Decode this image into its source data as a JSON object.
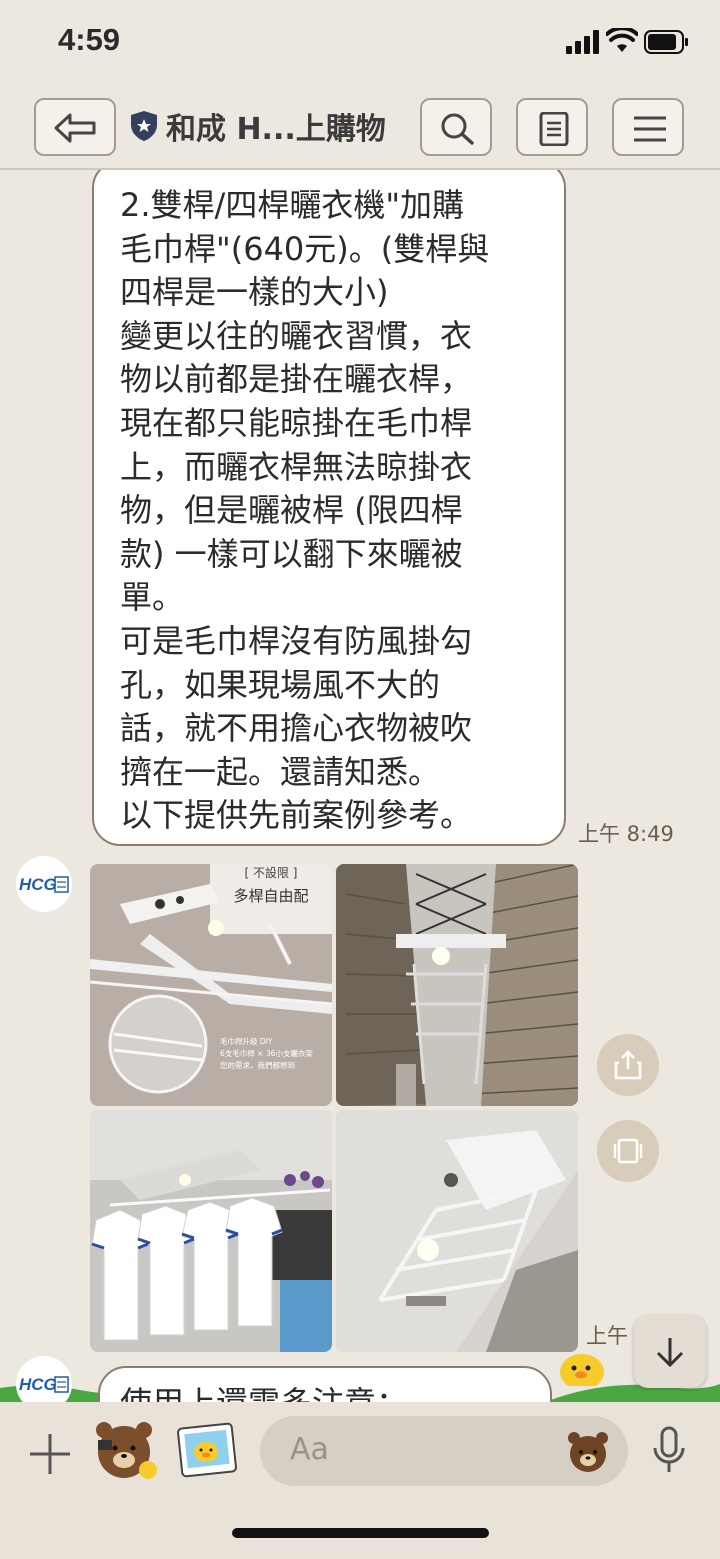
{
  "status_bar": {
    "time": "4:59"
  },
  "header": {
    "title": "和成 H...上購物"
  },
  "messages": [
    {
      "type": "text",
      "lines": [
        "2.雙桿/四桿曬衣機\"加購",
        "毛巾桿\"(640元)。(雙桿與",
        "四桿是一樣的大小)",
        "變更以往的曬衣習慣，衣",
        "物以前都是掛在曬衣桿，",
        "現在都只能晾掛在毛巾桿",
        "上，而曬衣桿無法晾掛衣",
        "物，但是曬被桿 (限四桿",
        "款) 一樣可以翻下來曬被",
        "單。",
        "可是毛巾桿沒有防風掛勾",
        "孔，如果現場風不大的",
        "話，就不用擔心衣物被吹",
        "擠在一起。還請知悉。",
        "以下提供先前案例參考。"
      ],
      "time": "上午 8:49"
    },
    {
      "type": "images",
      "sender_logo": "HCG",
      "promo": {
        "badge": "[ 不設限 ]",
        "headline": "多桿自由配",
        "caption_1": "毛巾桿升級 DIY",
        "caption_2": "6支毛巾桿 × 36小支曬衣架",
        "caption_3": "您的需求，我們都想到"
      },
      "time": "上午"
    },
    {
      "type": "text",
      "partial_text": "使用上還需多注意："
    }
  ],
  "input": {
    "placeholder": "Aa"
  },
  "icons": {
    "back": "back-arrow-icon",
    "search": "search-icon",
    "notes": "notes-icon",
    "menu": "menu-icon",
    "share": "share-icon",
    "album": "album-icon",
    "scroll_down": "arrow-down-icon",
    "plus": "plus-icon",
    "mic": "mic-icon"
  },
  "colors": {
    "background": "#ece7df",
    "bubble_border": "#8c7c6c",
    "button_fill": "#d8ccbb"
  }
}
